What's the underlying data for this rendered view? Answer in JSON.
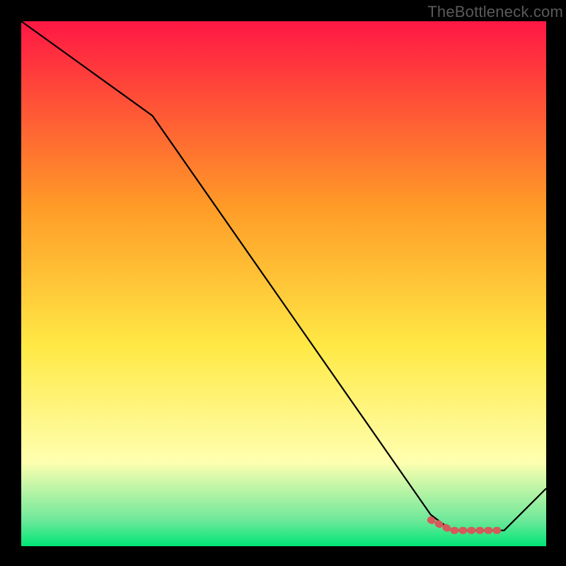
{
  "watermark": "TheBottleneck.com",
  "colors": {
    "top": "#ff1744",
    "mid1": "#ff9a27",
    "mid2": "#ffe945",
    "mid3": "#ffffb0",
    "nearBot": "#6fe89a",
    "bottom": "#00e676",
    "line": "#000000",
    "marker": "#d65a5a"
  },
  "chart_data": {
    "type": "line",
    "title": "",
    "xlabel": "",
    "ylabel": "",
    "xlim": [
      0,
      100
    ],
    "ylim": [
      0,
      100
    ],
    "series": [
      {
        "name": "curve",
        "x": [
          0,
          25,
          78,
          82,
          88,
          92,
          100
        ],
        "values": [
          100,
          82,
          6,
          3,
          3,
          3,
          11
        ]
      }
    ],
    "markers": {
      "name": "highlight-band",
      "x": [
        78,
        80,
        82,
        84,
        86,
        88,
        90,
        92
      ],
      "values": [
        5,
        4,
        3,
        3,
        3,
        3,
        3,
        3
      ]
    }
  }
}
